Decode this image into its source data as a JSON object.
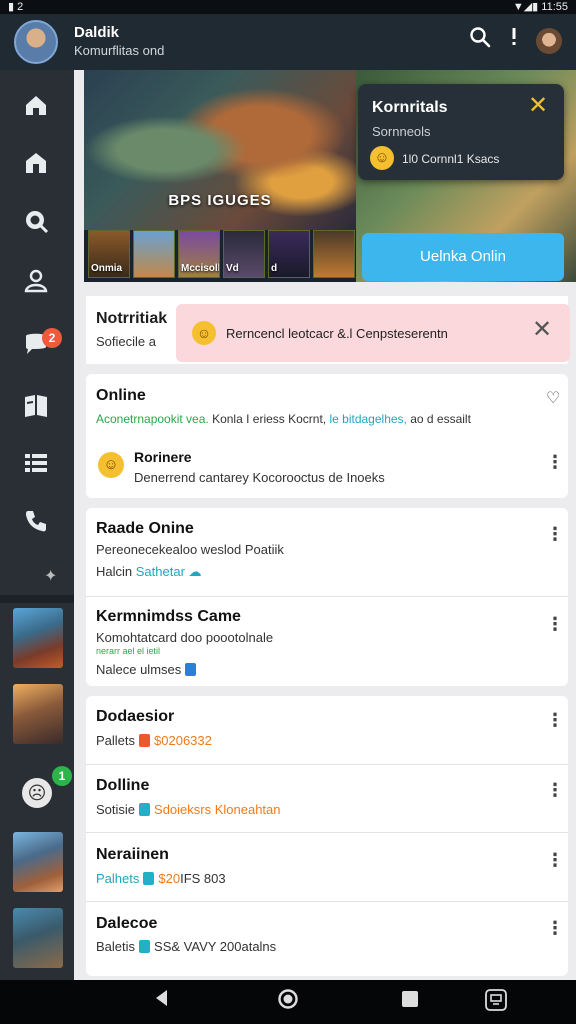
{
  "status": {
    "left": "▮ 2",
    "right": "▼◢▮ 11:55"
  },
  "header": {
    "title": "Daldik",
    "subtitle": "Komurflitas ond",
    "search_icon": "search-icon",
    "more_icon": "more-vert-icon"
  },
  "sidebar": {
    "icons": [
      "home-icon",
      "store-icon",
      "search-chat-icon",
      "users-icon",
      "chat-bubble-icon",
      "book-icon",
      "grid-icon",
      "phone-icon"
    ],
    "chat_badge": "2",
    "online_badge": "1",
    "pin": "✦"
  },
  "banner": {
    "caption": "BPS IGUGES",
    "strip": [
      "Onmia",
      "",
      "Mccisollks",
      "Vd",
      "d",
      ""
    ]
  },
  "popup": {
    "title": "Kornritals",
    "subtitle": "Sornneols",
    "text": "1l0 Cornnl1 Ksacs"
  },
  "cta": {
    "label": "Uelnka Onlin"
  },
  "notification": {
    "title": "Notrritiak",
    "subtitle": "Sofiecile a",
    "toast_text": "Rerncencl leotcacr &.l Cenpsteserentn"
  },
  "online_card": {
    "title": "Online",
    "desc_green": "Aconetrnapookit vea.",
    "desc_mid": " Konla I eriess Kocrnt, ",
    "desc_teal": "le bitdagelhes,",
    "desc_end": " ao d essailt",
    "sub_title": "Rorinere",
    "sub_text": "Denerrend cantarey Kocorooctus de Inoeks"
  },
  "group1": [
    {
      "title": "Raade Onine",
      "line1": "Pereonecekealoo weslod Poatiik",
      "line2_pre": "Halcin ",
      "line2_teal": "Sathetar",
      "line2_icon": "cloud-icon"
    },
    {
      "title": "Kermnimdss Came",
      "line1": "Komohtatcard doo poootolnale",
      "line2_green": "nerarr ael el ietil",
      "line2": "Nalece ulmses"
    }
  ],
  "group2": [
    {
      "title": "Dodaesior",
      "pre": "Pallets",
      "tag": "red",
      "value": "$0206332",
      "color": "orange"
    },
    {
      "title": "Dolline",
      "pre": "Sotisie",
      "tag": "teal",
      "value": "Sdoieksrs Kloneahtan",
      "color": "orange"
    },
    {
      "title": "Neraiinen",
      "pre": "Palhets",
      "tag": "teal",
      "value_colored": "$20",
      "value_rest": "IFS 803",
      "color": "orange"
    },
    {
      "title": "Dalecoe",
      "pre": "Baletis",
      "tag": "teal",
      "value": "SS& VAVY 200atalns",
      "color": "plain"
    }
  ],
  "navbar": [
    "back-icon",
    "home-circle-icon",
    "recents-icon",
    "assistant-icon"
  ]
}
